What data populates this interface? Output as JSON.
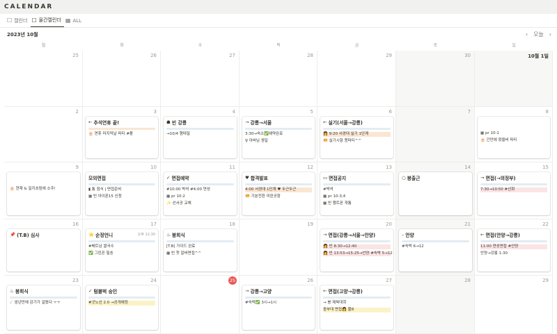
{
  "app": {
    "title": "CALENDAR"
  },
  "views": [
    {
      "icon": "☐",
      "label": "캘린더"
    },
    {
      "icon": "☐",
      "label": "올간캘린더"
    },
    {
      "icon": "▦",
      "label": "ALL"
    }
  ],
  "header": {
    "month": "2023년 10월",
    "today_label": "오늘",
    "prev": "‹",
    "next": "›"
  },
  "weekdays": [
    "월",
    "화",
    "수",
    "목",
    "금",
    "토",
    "일"
  ],
  "weeks": [
    [
      "25",
      "26",
      "27",
      "28",
      "29",
      "30",
      "10월 1일"
    ],
    [
      "2",
      "3",
      "4",
      "5",
      "6",
      "7",
      "8"
    ],
    [
      "9",
      "10",
      "11",
      "12",
      "13",
      "14",
      "15"
    ],
    [
      "16",
      "17",
      "18",
      "19",
      "20",
      "21",
      "22"
    ],
    [
      "23",
      "24",
      "25",
      "26",
      "27",
      "28",
      "29"
    ]
  ],
  "cards": {
    "w2d1": {
      "title": "추석연휴 끝!",
      "icon": "←",
      "lines": [
        "🎂 연휴 마지막날 파티 #풍"
      ]
    },
    "w2d2": {
      "title": "빈 강릉",
      "icon": "☗",
      "lines": [
        "→10/4 행테질"
      ]
    },
    "w2d3": {
      "title": "강릉→서울",
      "icon": "→",
      "lines": [
        "3:30→숙소✅예약완료",
        "♀ 아버님 생일"
      ]
    },
    "w2d4": {
      "title": "실기(서울→강릉)",
      "icon": "←",
      "lines": [
        "👩 9:20 서경대 실기 1단계",
        "🥯 실기시험 쫑파티^^"
      ]
    },
    "w2d6": {
      "title": "",
      "icon": "",
      "lines": [
        "▦ pr 10-1",
        "🎂 간만에 왔을비 파티"
      ]
    },
    "w3d0": {
      "title": "",
      "icon": "",
      "lines": [
        "🎂 현재 & 일지초림에 소주!"
      ]
    },
    "w3d1": {
      "title": "모의면접",
      "icon": "",
      "lines": [
        "▮ 통 점식 | 면접준비",
        "▦ 빈 아이폰15 신청"
      ]
    },
    "w3d2": {
      "title": "면접예약",
      "icon": "✓",
      "lines": [
        "#10:00 박석 #4:00 연성",
        "▦ pr 10-2",
        "✨ 선서공 교체"
      ]
    },
    "w3d3": {
      "title": "합격발표",
      "icon": "♥",
      "lines": [
        "4:00 서경대 1단계 ♥ 두근두근",
        "🥯 기분전환 미핀공항"
      ]
    },
    "w3d4": {
      "title": "면접공지",
      "icon": "▭",
      "lines": [
        "#박석",
        "▦ pr 10-3,4",
        "▦ 빈 행트폰 개통"
      ]
    },
    "w3d5": {
      "title": "봉출근",
      "icon": "○",
      "lines": []
    },
    "w3d6": {
      "title": "면접(→의정부)",
      "icon": "→",
      "lines": [
        "7:30→10:50 #선화"
      ]
    },
    "w4d0": {
      "title": "(T.B) 심사",
      "icon": "📌",
      "lines": []
    },
    "w4d1": {
      "title": "순정언니",
      "icon": "⭐",
      "time": "오후 12:30",
      "lines": [
        "#베트남 쌀국수",
        "✅ 그린픈 필송"
      ]
    },
    "w4d2": {
      "title": "봉회식",
      "icon": "♨",
      "lines": [
        "[T.B] 가이드 완료",
        "▦ 빈 첫 알바면접^^"
      ]
    },
    "w4d4": {
      "title": "면접(강릉→서울→안양)",
      "icon": "→",
      "lines": [
        "👩 빈 8:30→12:40",
        "👩 빈 13:53→15:25→안양 #숙박 5→12"
      ]
    },
    "w4d5": {
      "title": "안양",
      "icon": "–",
      "lines": [
        "#숙박 6→12"
      ]
    },
    "w4d6": {
      "title": "면접(안양→강릉)",
      "icon": "←",
      "lines": [
        "11:00 연성면접 #안양",
        "안양→강릉 1:30"
      ]
    },
    "w5d0": {
      "title": "봉회식",
      "icon": "♨",
      "lines": [
        "☄ 엄년만에 감기가 걸렸다 ㅜㅜ"
      ]
    },
    "w5d1": {
      "title": "텀블벅 승인",
      "icon": "✓",
      "lines": [
        "#굿노선 2.0 →공개예정"
      ]
    },
    "w5d3": {
      "title": "강릉→고양",
      "icon": "→",
      "lines": [
        "#숙박✅ 3시→1시"
      ]
    },
    "w5d4": {
      "title": "면접(고양→강릉)",
      "icon": "←",
      "lines": [
        "→ 봉 제육대회",
        "중부대 면접👩 불8"
      ]
    }
  }
}
